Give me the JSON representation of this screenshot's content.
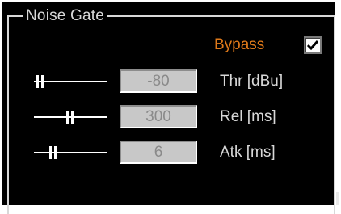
{
  "group": {
    "title": "Noise Gate"
  },
  "bypass": {
    "label": "Bypass",
    "checked": true
  },
  "params": [
    {
      "value": "-80",
      "unit": "Thr [dBu]"
    },
    {
      "value": "300",
      "unit": "Rel [ms]"
    },
    {
      "value": "6",
      "unit": "Atk [ms]"
    }
  ],
  "colors": {
    "background": "#000000",
    "text": "#d8d8d8",
    "accent": "#e07a1a",
    "field": "#c8c8c8",
    "field_text": "#8a8a8a"
  }
}
